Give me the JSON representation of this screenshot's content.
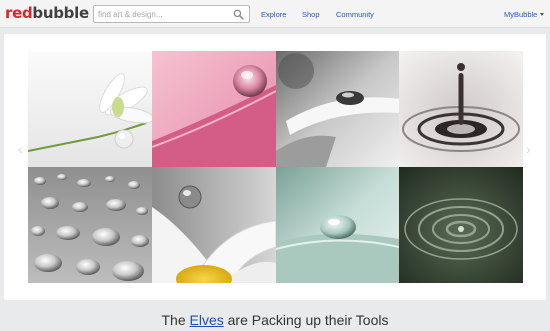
{
  "header": {
    "logo_red": "red",
    "logo_dark": "bubble",
    "search_placeholder": "find art & design...",
    "nav": [
      "Explore",
      "Shop",
      "Community"
    ],
    "account": "MyBubble"
  },
  "gallery": {
    "nav_left_icon": "chevron-left-icon",
    "nav_right_icon": "chevron-right-icon",
    "tiles": [
      {
        "subject": "white snowdrop with water drop",
        "palette": [
          "#f3f3f3",
          "#cfd6c4"
        ]
      },
      {
        "subject": "water drop on pink petal",
        "palette": [
          "#f0a9c0",
          "#d04b7c"
        ]
      },
      {
        "subject": "water drop on white petal, greyscale",
        "palette": [
          "#b8b8b8",
          "#3c3c3c"
        ]
      },
      {
        "subject": "water drop splash ripple",
        "palette": [
          "#e6e2e2",
          "#2b2424"
        ]
      },
      {
        "subject": "water droplets on grey surface",
        "palette": [
          "#9a9a9a",
          "#3d3d3d"
        ]
      },
      {
        "subject": "water drop on daisy petals",
        "palette": [
          "#d0d0d0",
          "#e8c21f"
        ]
      },
      {
        "subject": "water drop on pale green leaf",
        "palette": [
          "#c4d9d4",
          "#5f8a7e"
        ]
      },
      {
        "subject": "dark green water ripples",
        "palette": [
          "#2f3a2d",
          "#9aa896"
        ]
      }
    ]
  },
  "caption": {
    "before": "The ",
    "link": "Elves",
    "after": " are Packing up their Tools"
  },
  "colors": {
    "brand_red": "#d9262c",
    "link_blue": "#2a58b7",
    "page_bg": "#e9eaec"
  }
}
